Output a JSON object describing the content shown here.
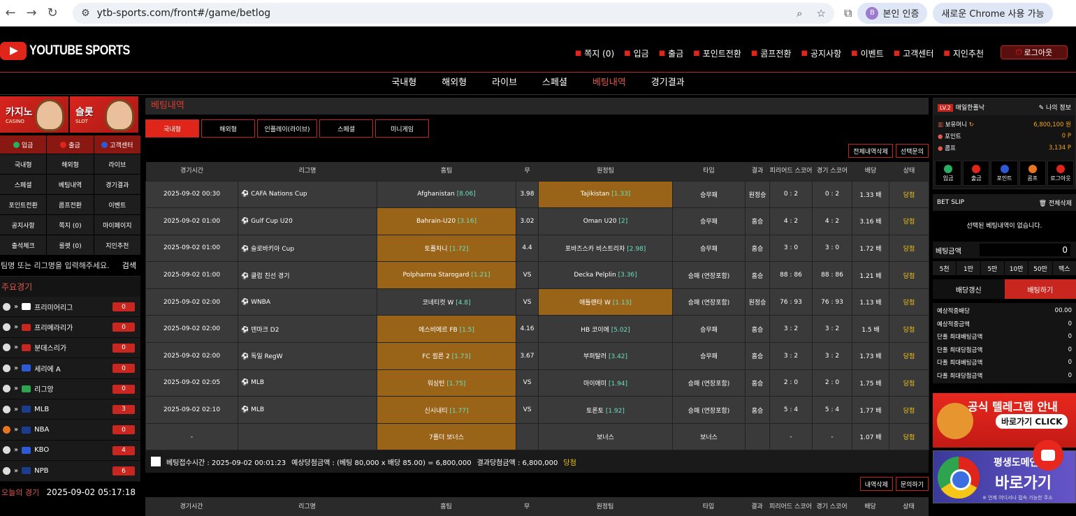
{
  "browser": {
    "url": "ytb-sports.com/front#/game/betlog",
    "profile_badge": "본인 인증",
    "profile_initial": "B",
    "chrome_notice": "새로운 Chrome 사용 가능"
  },
  "header": {
    "logo_text": "YOUTUBE SPORTS",
    "menu": [
      "쪽지 (0)",
      "입금",
      "출금",
      "포인트전환",
      "콤프전환",
      "공지사항",
      "이벤트",
      "고객센터",
      "지인추천"
    ],
    "logout": "로그아웃"
  },
  "main_nav": [
    "국내형",
    "해외형",
    "라이브",
    "스페셜",
    "베팅내역",
    "경기결과"
  ],
  "left": {
    "banners": [
      {
        "title": "카지노",
        "sub": "CASINO"
      },
      {
        "title": "슬롯",
        "sub": "SLOT"
      }
    ],
    "quick": [
      "입금",
      "출금",
      "고객센터"
    ],
    "grid": [
      "국내형",
      "해외형",
      "라이브",
      "스페셜",
      "베팅내역",
      "경기결과",
      "포인트전환",
      "콤프전환",
      "이벤트",
      "공지사항",
      "쪽지 (0)",
      "마이페이지",
      "출석체크",
      "룰렛 (0)",
      "지인추천"
    ],
    "search_placeholder": "팀명 또는 리그명을 입력해주세요.",
    "search_btn": "검색",
    "featured_title": "주요경기",
    "leagues": [
      {
        "name": "프리미어리그",
        "count": "0"
      },
      {
        "name": "프리메라리가",
        "count": "0"
      },
      {
        "name": "분데스리가",
        "count": "0"
      },
      {
        "name": "세리에 A",
        "count": "0"
      },
      {
        "name": "리그앙",
        "count": "0"
      },
      {
        "name": "MLB",
        "count": "3"
      },
      {
        "name": "NBA",
        "count": "0"
      },
      {
        "name": "KBO",
        "count": "4"
      },
      {
        "name": "NPB",
        "count": "6"
      }
    ],
    "today_label": "오늘의 경기",
    "today_time": "2025-09-02 05:17:18"
  },
  "center": {
    "title": "베팅내역",
    "tabs": [
      "국내형",
      "해외형",
      "인플레이(라이브)",
      "스페셜",
      "미니게임"
    ],
    "actions": [
      "전체내역삭제",
      "선택문의"
    ],
    "columns": [
      "경기시간",
      "리그명",
      "홈팀",
      "무",
      "원정팀",
      "타입",
      "결과",
      "피리어드 스코어",
      "경기 스코어",
      "배당",
      "상태"
    ],
    "rows": [
      {
        "time": "2025-09-02 00:30",
        "league": "CAFA Nations Cup",
        "home": "Afghanistan",
        "home_odds": "[8.06]",
        "draw": "3.98",
        "away": "Tajikistan",
        "away_odds": "[1.33]",
        "type": "승무패",
        "result": "원정승",
        "period": "0 : 2",
        "score": "0 : 2",
        "odds": "1.33 배",
        "status": "당첨",
        "hl": "away"
      },
      {
        "time": "2025-09-02 01:00",
        "league": "Gulf Cup U20",
        "home": "Bahrain-U20",
        "home_odds": "[3.16]",
        "draw": "3.02",
        "away": "Oman U20",
        "away_odds": "[2]",
        "type": "승무패",
        "result": "홈승",
        "period": "4 : 2",
        "score": "4 : 2",
        "odds": "3.16 배",
        "status": "당첨",
        "hl": "home"
      },
      {
        "time": "2025-09-02 01:00",
        "league": "슬로바키아 Cup",
        "home": "토폴차니",
        "home_odds": "[1.72]",
        "draw": "4.4",
        "away": "포바즈스카 비스트리차",
        "away_odds": "[2.98]",
        "type": "승무패",
        "result": "홈승",
        "period": "3 : 0",
        "score": "3 : 0",
        "odds": "1.72 배",
        "status": "당첨",
        "hl": "home"
      },
      {
        "time": "2025-09-02 01:00",
        "league": "클럽 친선 경기",
        "home": "Polpharma Starogard",
        "home_odds": "[1.21]",
        "draw": "VS",
        "away": "Decka Pelplin",
        "away_odds": "[3.36]",
        "type": "승패 (연장포함)",
        "result": "홈승",
        "period": "88 : 86",
        "score": "88 : 86",
        "odds": "1.21 배",
        "status": "당첨",
        "hl": "home"
      },
      {
        "time": "2025-09-02 02:00",
        "league": "WNBA",
        "home": "코네티컷 W",
        "home_odds": "[4.8]",
        "draw": "VS",
        "away": "애틀랜타 W",
        "away_odds": "[1.13]",
        "type": "승패 (연장포함)",
        "result": "원정승",
        "period": "76 : 93",
        "score": "76 : 93",
        "odds": "1.13 배",
        "status": "당첨",
        "hl": "away"
      },
      {
        "time": "2025-09-02 02:00",
        "league": "덴마크 D2",
        "home": "에스비에르 FB",
        "home_odds": "[1.5]",
        "draw": "4.16",
        "away": "HB 코이에",
        "away_odds": "[5.02]",
        "type": "승무패",
        "result": "홈승",
        "period": "3 : 2",
        "score": "3 : 2",
        "odds": "1.5 배",
        "status": "당첨",
        "hl": "home"
      },
      {
        "time": "2025-09-02 02:00",
        "league": "독일 RegW",
        "home": "FC 쾰른 2",
        "home_odds": "[1.73]",
        "draw": "3.67",
        "away": "부퍼탈러",
        "away_odds": "[3.42]",
        "type": "승무패",
        "result": "홈승",
        "period": "3 : 2",
        "score": "3 : 2",
        "odds": "1.73 배",
        "status": "당첨",
        "hl": "home"
      },
      {
        "time": "2025-09-02 02:05",
        "league": "MLB",
        "home": "워싱턴",
        "home_odds": "[1.75]",
        "draw": "VS",
        "away": "마이애미",
        "away_odds": "[1.94]",
        "type": "승패 (연장포함)",
        "result": "홈승",
        "period": "2 : 0",
        "score": "2 : 0",
        "odds": "1.75 배",
        "status": "당첨",
        "hl": "home"
      },
      {
        "time": "2025-09-02 02:10",
        "league": "MLB",
        "home": "신시내티",
        "home_odds": "[1.77]",
        "draw": "VS",
        "away": "토론토",
        "away_odds": "[1.92]",
        "type": "승패 (연장포함)",
        "result": "홈승",
        "period": "5 : 4",
        "score": "5 : 4",
        "odds": "1.77 배",
        "status": "당첨",
        "hl": "home"
      },
      {
        "time": "-",
        "league": "",
        "home": "7폴더 보너스",
        "home_odds": "",
        "draw": "",
        "away": "보너스",
        "away_odds": "",
        "type": "보너스",
        "result": "",
        "period": "-",
        "score": "-",
        "odds": "1.07 배",
        "status": "당첨",
        "hl": "home"
      }
    ],
    "summary": {
      "time": "베팅접수시간 : 2025-09-02 00:01:23",
      "expected": "예상당첨금액 : (베팅 80,000 x 배당 85.00) = 6,800,000",
      "result": "결과당첨금액 : 6,800,000",
      "status": "당첨"
    },
    "actions2": [
      "내역삭제",
      "문의하기"
    ]
  },
  "right": {
    "level": "LV.2",
    "username": "매일한폴낙",
    "my_info": "나의 정보",
    "money_label": "보유머니",
    "money": "6,800,100 원",
    "point_label": "포인트",
    "point": "0 P",
    "comp_label": "콤프",
    "comp": "3,134 P",
    "buttons": [
      "입금",
      "출금",
      "포인트",
      "콤프",
      "로그아웃"
    ],
    "slip_title": "BET SLIP",
    "slip_clear": "전체삭제",
    "slip_empty": "선택된 베팅내역이 없습니다.",
    "amount_label": "베팅금액",
    "amount_value": "0",
    "chips": [
      "5천",
      "1만",
      "5만",
      "10만",
      "50만",
      "맥스"
    ],
    "refresh": "배당갱신",
    "bet": "배팅하기",
    "infos": [
      {
        "k": "예상적중배당",
        "v": "00.00"
      },
      {
        "k": "예상적중금액",
        "v": "0"
      },
      {
        "k": "단폴 최대배팅금액",
        "v": "0"
      },
      {
        "k": "단폴 최대당첨금액",
        "v": "0"
      },
      {
        "k": "다폴 최대배팅금액",
        "v": "0"
      },
      {
        "k": "다폴 최대당첨금액",
        "v": "0"
      }
    ],
    "promo1_title": "공식 텔레그램 안내",
    "promo1_cta": "바로가기 CLICK",
    "promo2_title": "평생도메인",
    "promo2_big": "바로가기",
    "promo2_sub": "※ 언제 어디서나 접속 가능한 주소"
  }
}
